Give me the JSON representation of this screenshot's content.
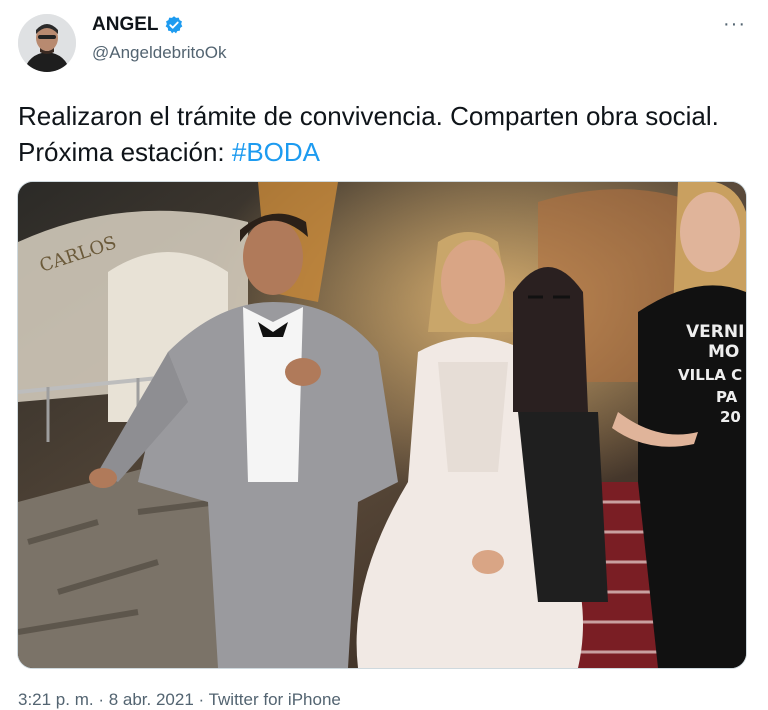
{
  "user": {
    "display_name": "ANGEL",
    "handle": "@AngeldebritoOk",
    "verified_icon": "verified-badge-icon",
    "avatar_icon": "avatar"
  },
  "menu": {
    "more_label": "···"
  },
  "tweet": {
    "text_part1": "Realizaron el trámite de convivencia. Comparten obra social. Próxima estación: ",
    "hashtag": "#BODA"
  },
  "photo": {
    "sign_text": "CARLOS",
    "shirt_line1": "VERNI",
    "shirt_line2": "MO",
    "shirt_line3": "VILLA C",
    "shirt_line4": "PA",
    "shirt_line5": "20"
  },
  "meta": {
    "timestamp": "3:21 p. m. · 8 abr. 2021 · Twitter for iPhone"
  },
  "colors": {
    "accent": "#1d9bf0",
    "text": "#0f1419",
    "secondary": "#536471"
  }
}
